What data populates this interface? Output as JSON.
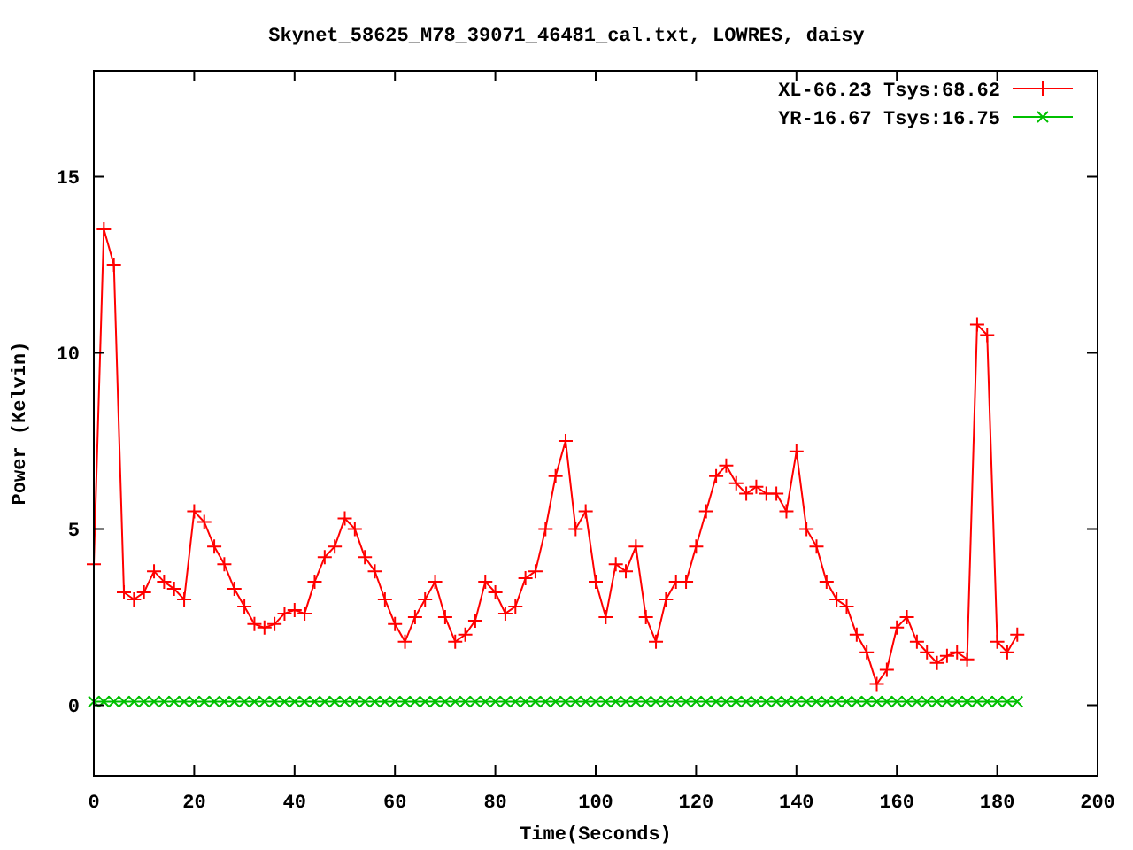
{
  "chart": {
    "chart_data": {
      "type": "line",
      "title": "Skynet_58625_M78_39071_46481_cal.txt, LOWRES, daisy",
      "xlabel": "Time(Seconds)",
      "ylabel": "Power (Kelvin)",
      "x": [
        0,
        2,
        4,
        6,
        8,
        10,
        12,
        14,
        16,
        18,
        20,
        22,
        24,
        26,
        28,
        30,
        32,
        34,
        36,
        38,
        40,
        42,
        44,
        46,
        48,
        50,
        52,
        54,
        56,
        58,
        60,
        62,
        64,
        66,
        68,
        70,
        72,
        74,
        76,
        78,
        80,
        82,
        84,
        86,
        88,
        90,
        92,
        94,
        96,
        98,
        100,
        102,
        104,
        106,
        108,
        110,
        112,
        114,
        116,
        118,
        120,
        122,
        124,
        126,
        128,
        130,
        132,
        134,
        136,
        138,
        140,
        142,
        144,
        146,
        148,
        150,
        152,
        154,
        156,
        158,
        160,
        162,
        164,
        166,
        168,
        170,
        172,
        174,
        176,
        178,
        180,
        182,
        184
      ],
      "series": [
        {
          "name": "XL-66.23 Tsys:68.62",
          "color": "#ff0000",
          "marker": "plus",
          "values": [
            4,
            13.5,
            12.5,
            3.2,
            3.0,
            3.2,
            3.8,
            3.5,
            3.3,
            3.0,
            5.5,
            5.2,
            4.5,
            4.0,
            3.3,
            2.8,
            2.3,
            2.2,
            2.3,
            2.6,
            2.7,
            2.6,
            3.5,
            4.2,
            4.5,
            5.3,
            5.0,
            4.2,
            3.8,
            3.0,
            2.3,
            1.8,
            2.5,
            3.0,
            3.5,
            2.5,
            1.8,
            2.0,
            2.4,
            3.5,
            3.2,
            2.6,
            2.8,
            3.6,
            3.8,
            5.0,
            6.5,
            7.5,
            5.0,
            5.5,
            3.5,
            2.5,
            4.0,
            3.8,
            4.5,
            2.5,
            1.8,
            3.0,
            3.5,
            3.5,
            4.5,
            5.5,
            6.5,
            6.8,
            6.3,
            6.0,
            6.2,
            6.0,
            6.0,
            5.5,
            7.2,
            5.0,
            4.5,
            3.5,
            3.0,
            2.8,
            2.0,
            1.5,
            0.6,
            1.0,
            2.2,
            2.5,
            1.8,
            1.5,
            1.2,
            1.4,
            1.5,
            1.3,
            10.8,
            10.5,
            1.8,
            1.5,
            2.0
          ]
        },
        {
          "name": "YR-16.67 Tsys:16.75",
          "color": "#00c000",
          "marker": "cross",
          "values": [
            0.1,
            0.1,
            0.1,
            0.1,
            0.1,
            0.1,
            0.1,
            0.1,
            0.1,
            0.1,
            0.1,
            0.1,
            0.1,
            0.1,
            0.1,
            0.1,
            0.1,
            0.1,
            0.1,
            0.1,
            0.1,
            0.1,
            0.1,
            0.1,
            0.1,
            0.1,
            0.1,
            0.1,
            0.1,
            0.1,
            0.1,
            0.1,
            0.1,
            0.1,
            0.1,
            0.1,
            0.1,
            0.1,
            0.1,
            0.1,
            0.1,
            0.1,
            0.1,
            0.1,
            0.1,
            0.1,
            0.1,
            0.1,
            0.1,
            0.1,
            0.1,
            0.1,
            0.1,
            0.1,
            0.1,
            0.1,
            0.1,
            0.1,
            0.1,
            0.1,
            0.1,
            0.1,
            0.1,
            0.1,
            0.1,
            0.1,
            0.1,
            0.1,
            0.1,
            0.1,
            0.1,
            0.1,
            0.1,
            0.1,
            0.1,
            0.1,
            0.1,
            0.1,
            0.1,
            0.1,
            0.1,
            0.1,
            0.1,
            0.1,
            0.1,
            0.1,
            0.1,
            0.1,
            0.1,
            0.1,
            0.1,
            0.1,
            0.1
          ]
        }
      ],
      "legend": true,
      "xlim": [
        0,
        200
      ],
      "ylim": [
        -2,
        18
      ],
      "xticks": [
        0,
        20,
        40,
        60,
        80,
        100,
        120,
        140,
        160,
        180,
        200
      ],
      "yticks": [
        0,
        5,
        10,
        15
      ]
    }
  }
}
